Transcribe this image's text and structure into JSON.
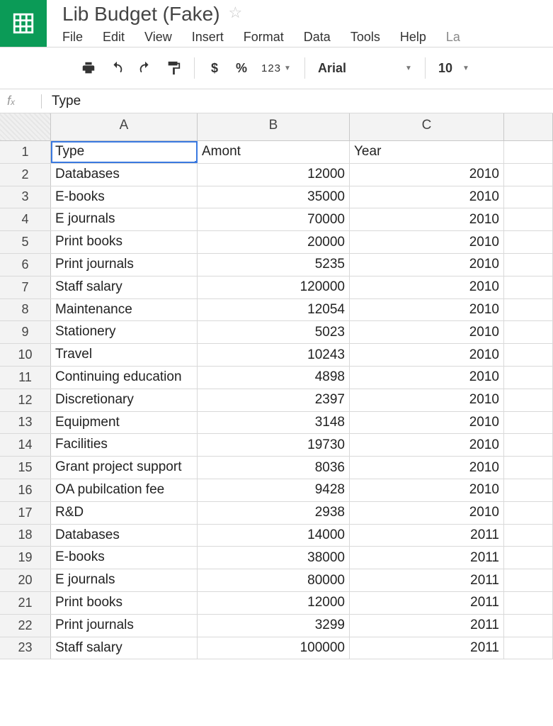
{
  "document": {
    "title": "Lib Budget (Fake)"
  },
  "menu": {
    "file": "File",
    "edit": "Edit",
    "view": "View",
    "insert": "Insert",
    "format": "Format",
    "data": "Data",
    "tools": "Tools",
    "help": "Help",
    "last": "La"
  },
  "toolbar": {
    "currency": "$",
    "percent": "%",
    "numformat": "123",
    "font": "Arial",
    "fontsize": "10"
  },
  "formula": {
    "fx": "fx",
    "value": "Type"
  },
  "columns": [
    "A",
    "B",
    "C"
  ],
  "headers": {
    "a": "Type",
    "b": "Amont",
    "c": "Year"
  },
  "rows": [
    {
      "n": "1",
      "a": "Type",
      "b": "Amont",
      "c": "Year",
      "header": true
    },
    {
      "n": "2",
      "a": "Databases",
      "b": "12000",
      "c": "2010"
    },
    {
      "n": "3",
      "a": "E-books",
      "b": "35000",
      "c": "2010"
    },
    {
      "n": "4",
      "a": "E journals",
      "b": "70000",
      "c": "2010"
    },
    {
      "n": "5",
      "a": "Print books",
      "b": "20000",
      "c": "2010"
    },
    {
      "n": "6",
      "a": "Print journals",
      "b": "5235",
      "c": "2010"
    },
    {
      "n": "7",
      "a": "Staff salary",
      "b": "120000",
      "c": "2010"
    },
    {
      "n": "8",
      "a": "Maintenance",
      "b": "12054",
      "c": "2010"
    },
    {
      "n": "9",
      "a": "Stationery",
      "b": "5023",
      "c": "2010"
    },
    {
      "n": "10",
      "a": "Travel",
      "b": "10243",
      "c": "2010"
    },
    {
      "n": "11",
      "a": "Continuing education",
      "b": "4898",
      "c": "2010"
    },
    {
      "n": "12",
      "a": "Discretionary",
      "b": "2397",
      "c": "2010"
    },
    {
      "n": "13",
      "a": "Equipment",
      "b": "3148",
      "c": "2010"
    },
    {
      "n": "14",
      "a": "Facilities",
      "b": "19730",
      "c": "2010"
    },
    {
      "n": "15",
      "a": "Grant project support",
      "b": "8036",
      "c": "2010"
    },
    {
      "n": "16",
      "a": "OA pubilcation fee",
      "b": "9428",
      "c": "2010"
    },
    {
      "n": "17",
      "a": "R&D",
      "b": "2938",
      "c": "2010"
    },
    {
      "n": "18",
      "a": "Databases",
      "b": "14000",
      "c": "2011"
    },
    {
      "n": "19",
      "a": "E-books",
      "b": "38000",
      "c": "2011"
    },
    {
      "n": "20",
      "a": "E journals",
      "b": "80000",
      "c": "2011"
    },
    {
      "n": "21",
      "a": "Print books",
      "b": "12000",
      "c": "2011"
    },
    {
      "n": "22",
      "a": "Print journals",
      "b": "3299",
      "c": "2011"
    },
    {
      "n": "23",
      "a": "Staff salary",
      "b": "100000",
      "c": "2011"
    }
  ]
}
